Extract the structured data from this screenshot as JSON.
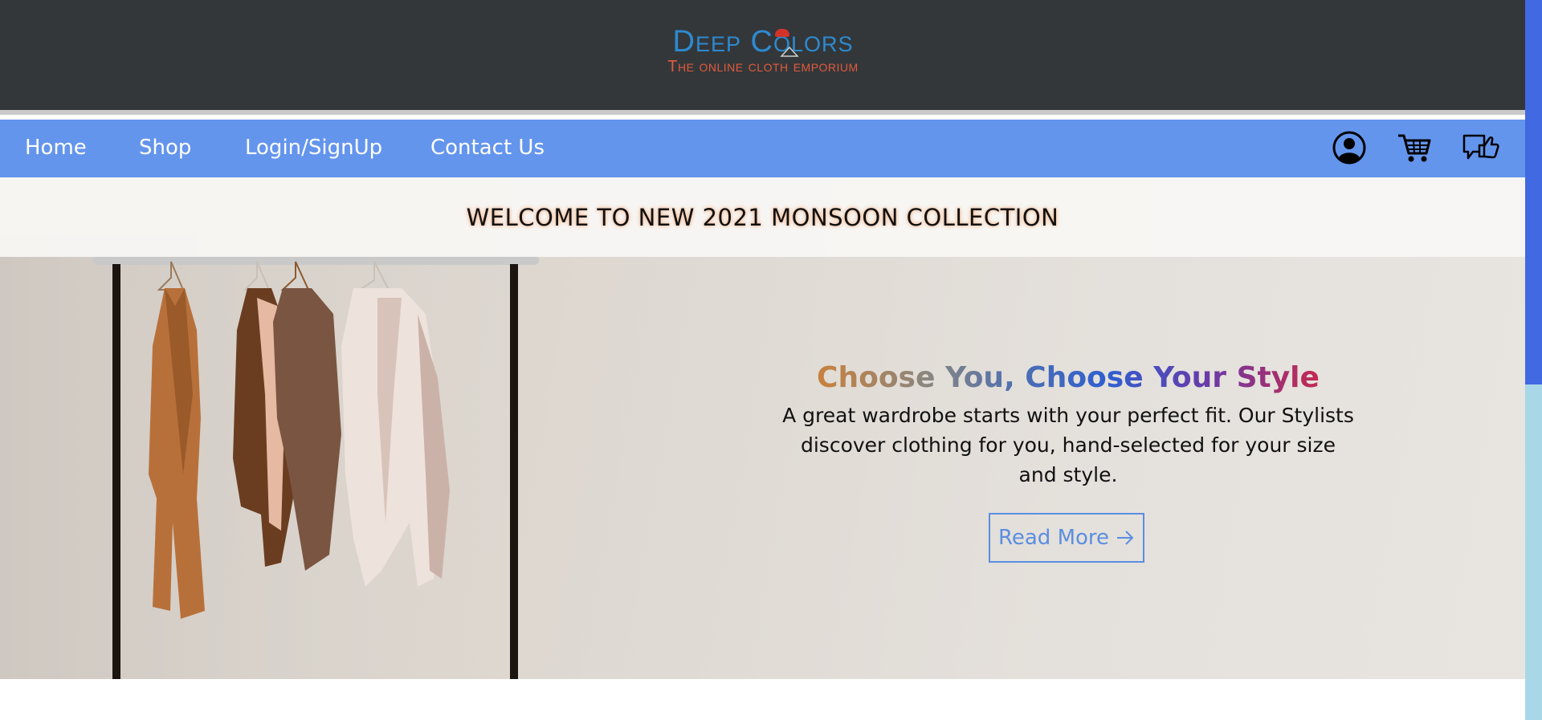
{
  "logo": {
    "title": "Deep Colors",
    "subtitle": "The online cloth emporium"
  },
  "nav": {
    "links": [
      {
        "label": "Home"
      },
      {
        "label": "Shop"
      },
      {
        "label": "Login/SignUp"
      },
      {
        "label": "Contact Us"
      }
    ],
    "icons": [
      "user-account-icon",
      "shopping-cart-icon",
      "feedback-thumbs-up-icon"
    ]
  },
  "hero": {
    "banner": "WELCOME TO NEW 2021 MONSOON COLLECTION",
    "title": "Choose You, Choose Your Style",
    "description": "A great wardrobe starts with your perfect fit. Our Stylists discover clothing for you, hand-selected for your size and style.",
    "button_label": "Read More"
  },
  "colors": {
    "header_bg": "#33373a",
    "nav_bg": "#6495ed",
    "logo_blue": "#2d8ad0",
    "logo_orange": "#e05b3d",
    "button_accent": "#5b8ee0",
    "scroll_thumb": "#4169e1",
    "scroll_track": "#a8d8e8"
  }
}
